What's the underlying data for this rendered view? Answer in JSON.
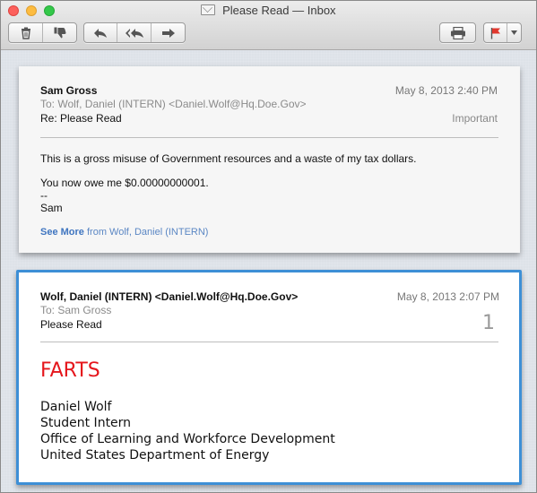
{
  "window": {
    "title": "Please Read — Inbox"
  },
  "toolbar": {
    "delete_icon": "trash-icon",
    "junk_icon": "thumbs-down-icon",
    "reply_icon": "reply-icon",
    "reply_all_icon": "reply-all-icon",
    "forward_icon": "forward-icon",
    "print_icon": "printer-icon",
    "flag_icon": "flag-icon",
    "flag_color": "#e0382e"
  },
  "messages": [
    {
      "from": "Sam Gross",
      "to": "To:  Wolf, Daniel (INTERN) <Daniel.Wolf@Hq.Doe.Gov>",
      "subject": "Re: Please Read",
      "date": "May 8, 2013  2:40 PM",
      "label": "Important",
      "body_line1": "This is a gross misuse of Government resources and a waste of my tax dollars.",
      "body_line2": "You now owe me $0.00000000001.",
      "body_line3": "--",
      "body_line4": "Sam",
      "see_more": "See More",
      "see_more_suffix": "from Wolf, Daniel (INTERN)"
    },
    {
      "from": "Wolf, Daniel (INTERN) <Daniel.Wolf@Hq.Doe.Gov>",
      "to": "To:  Sam Gross",
      "subject": "Please Read",
      "date": "May 8, 2013  2:07 PM",
      "count": "1",
      "headline": "FARTS",
      "headline_color": "#e5161c",
      "signature": [
        "Daniel Wolf",
        "Student Intern",
        "Office of Learning and Workforce Development",
        "United States Department of Energy"
      ]
    }
  ]
}
